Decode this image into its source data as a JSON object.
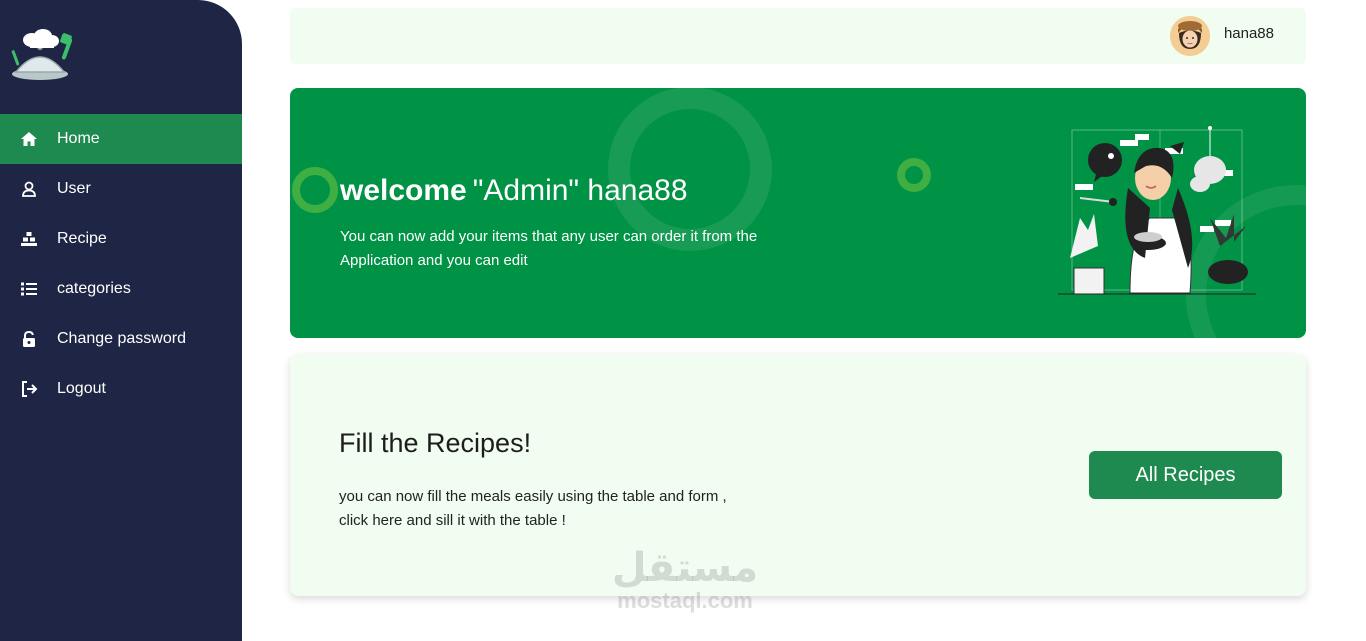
{
  "sidebar": {
    "items": [
      {
        "label": "Home",
        "icon": "home-icon",
        "active": true
      },
      {
        "label": "User",
        "icon": "user-icon",
        "active": false
      },
      {
        "label": "Recipe",
        "icon": "recipe-icon",
        "active": false
      },
      {
        "label": "categories",
        "icon": "list-icon",
        "active": false
      },
      {
        "label": "Change password",
        "icon": "unlock-icon",
        "active": false
      },
      {
        "label": "Logout",
        "icon": "logout-icon",
        "active": false
      }
    ]
  },
  "header": {
    "username": "hana88"
  },
  "hero": {
    "welcome": "welcome",
    "role_user": "\"Admin\" hana88",
    "text": "You can now add your items that any user can order it from the Application and you can edit"
  },
  "card": {
    "title": "Fill the Recipes!",
    "text_line1": "you can now fill the meals easily using the table and form ,",
    "text_line2": "click here and sill it with the table !",
    "button_label": "All Recipes"
  },
  "watermark": {
    "arabic": "مستقل",
    "latin": "mostaql.com"
  },
  "colors": {
    "sidebar_bg": "#1f2544",
    "accent": "#1e8a4f",
    "hero_bg": "#009245",
    "card_bg": "#f0fdf0"
  }
}
